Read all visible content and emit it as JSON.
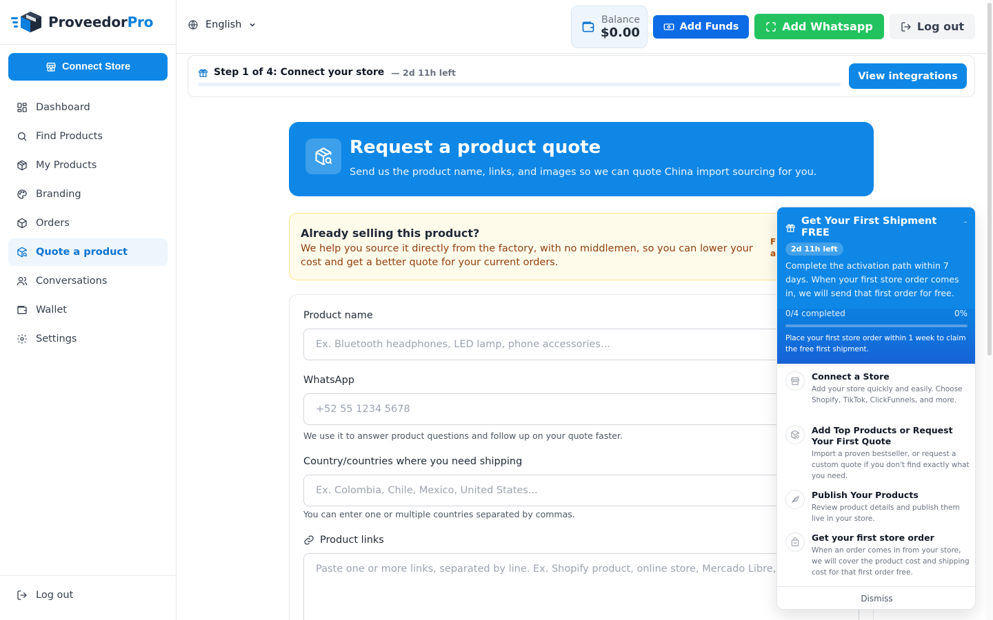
{
  "brand": {
    "name_main": "Proveedor",
    "name_accent": "Pro"
  },
  "sidebar": {
    "connect_store": "Connect Store",
    "items": [
      {
        "label": "Dashboard",
        "icon": "dashboard-icon"
      },
      {
        "label": "Find Products",
        "icon": "search-icon"
      },
      {
        "label": "My Products",
        "icon": "box-icon"
      },
      {
        "label": "Branding",
        "icon": "palette-icon"
      },
      {
        "label": "Orders",
        "icon": "package-icon"
      },
      {
        "label": "Quote a product",
        "icon": "package-search-icon",
        "active": true
      },
      {
        "label": "Conversations",
        "icon": "users-icon"
      },
      {
        "label": "Wallet",
        "icon": "wallet-icon"
      },
      {
        "label": "Settings",
        "icon": "gear-icon"
      }
    ],
    "logout": "Log out"
  },
  "header": {
    "language": "English",
    "balance_label": "Balance",
    "balance_value": "$0.00",
    "add_funds": "Add Funds",
    "add_whatsapp": "Add Whatsapp",
    "logout": "Log out"
  },
  "step": {
    "title": "Step 1 of 4: Connect your store",
    "time_left": "— 2d 11h left",
    "button": "View integrations",
    "progress": 0
  },
  "hero": {
    "title": "Request a product quote",
    "subtitle": "Send us the product name, links, and images so we can quote China import sourcing for you."
  },
  "selling": {
    "title": "Already selling this product?",
    "text": "We help you source it directly from the factory, with no middlemen, so you can lower your cost and get a better quote for your current orders.",
    "cut_1": "F",
    "cut_2": "a"
  },
  "form": {
    "product_name_label": "Product name",
    "product_name_placeholder": "Ex. Bluetooth headphones, LED lamp, phone accessories...",
    "whatsapp_label": "WhatsApp",
    "whatsapp_placeholder": "+52 55 1234 5678",
    "whatsapp_help": "We use it to answer product questions and follow up on your quote faster.",
    "countries_label": "Country/countries where you need shipping",
    "countries_placeholder": "Ex. Colombia, Chile, Mexico, United States...",
    "countries_help": "You can enter one or multiple countries separated by commas.",
    "links_label": "Product links",
    "links_placeholder": "Paste one or more links, separated by line. Ex. Shopify product, online store, Mercado Libre, sup"
  },
  "onboarding": {
    "title": "Get Your First Shipment FREE",
    "minimize": "-",
    "badge": "2d 11h left",
    "description": "Complete the activation path within 7 days. When your first store order comes in, we will send that first order for free.",
    "progress_text": "0/4 completed",
    "progress_percent": "0%",
    "progress_value": 0,
    "note": "Place your first store order within 1 week to claim the free first shipment.",
    "tasks": [
      {
        "title": "Connect a Store",
        "desc": "Add your store quickly and easily. Choose Shopify, TikTok, ClickFunnels, and more.",
        "icon": "store-icon"
      },
      {
        "title": "Add Top Products or Request Your First Quote",
        "desc": "Import a proven bestseller, or request a custom quote if you don't find exactly what you need.",
        "icon": "package-search-icon"
      },
      {
        "title": "Publish Your Products",
        "desc": "Review product details and publish them live in your store.",
        "icon": "rocket-icon"
      },
      {
        "title": "Get your first store order",
        "desc": "When an order comes in from your store, we will cover the product cost and shipping cost for that first order free.",
        "icon": "shopping-bag-icon"
      }
    ],
    "dismiss": "Dismiss"
  },
  "colors": {
    "primary": "#0e87e6",
    "whatsapp": "#22c35e",
    "funds": "#0e6be6",
    "warning_bg": "#fffbeb"
  }
}
